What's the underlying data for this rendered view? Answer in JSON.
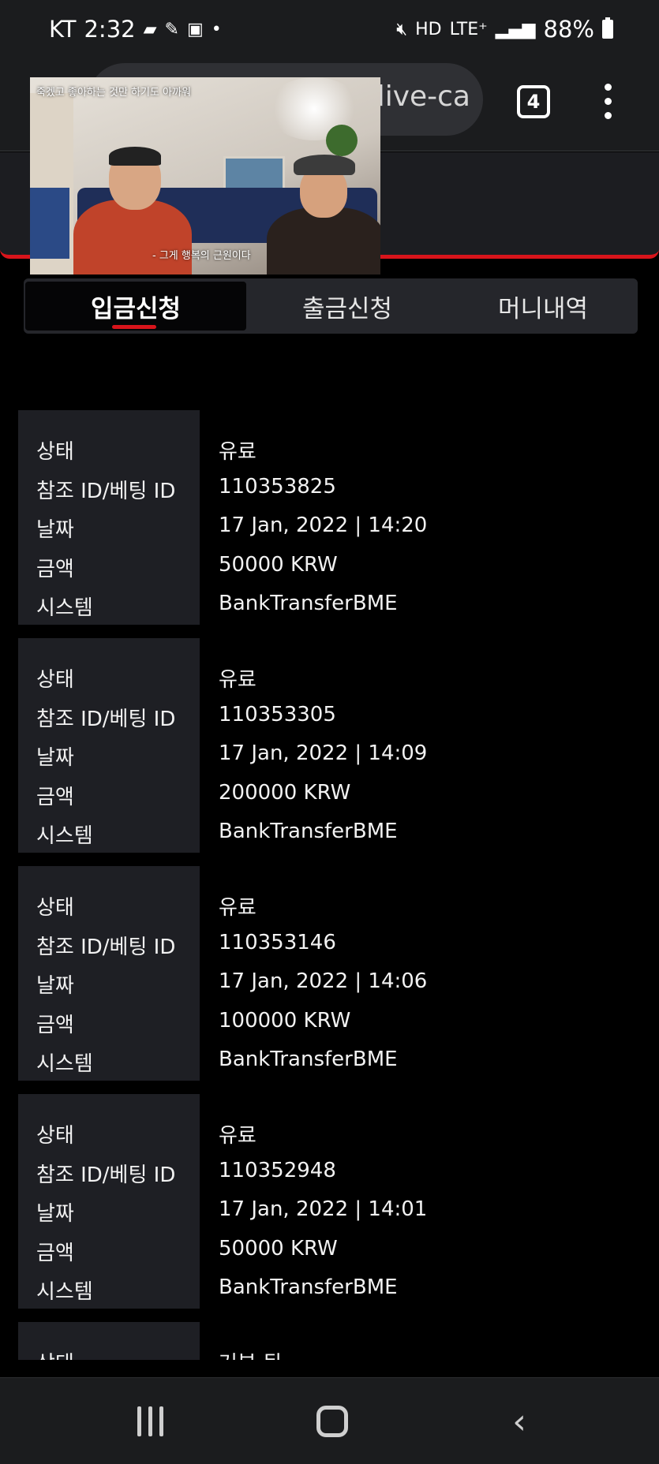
{
  "status_bar": {
    "carrier": "KT",
    "time": "2:32",
    "network": "LTE⁺",
    "battery": "88%",
    "icons": [
      "chat-icon",
      "volte-icon",
      "image-icon",
      "dot-icon",
      "mute-icon",
      "hd-icon",
      "signal-icon",
      "battery-icon"
    ]
  },
  "browser": {
    "url": "/live-ca",
    "tab_count": "4"
  },
  "video": {
    "top_caption": "죽겠고 좋아하는 것만 하기도 아까워",
    "subtitle": "- 그게 행복의 근원이다"
  },
  "tabs": [
    {
      "label": "입금신청",
      "active": true
    },
    {
      "label": "출금신청",
      "active": false
    },
    {
      "label": "머니내역",
      "active": false
    }
  ],
  "labels": {
    "status": "상태",
    "ref_id": "참조 ID/베팅 ID",
    "date": "날짜",
    "amount": "금액",
    "system": "시스템"
  },
  "records": [
    {
      "status": "유료",
      "ref_id": "110353825",
      "date": "17 Jan, 2022 | 14:20",
      "amount": "50000 KRW",
      "system": "BankTransferBME"
    },
    {
      "status": "유료",
      "ref_id": "110353305",
      "date": "17 Jan, 2022 | 14:09",
      "amount": "200000 KRW",
      "system": "BankTransferBME"
    },
    {
      "status": "유료",
      "ref_id": "110353146",
      "date": "17 Jan, 2022 | 14:06",
      "amount": "100000 KRW",
      "system": "BankTransferBME"
    },
    {
      "status": "유료",
      "ref_id": "110352948",
      "date": "17 Jan, 2022 | 14:01",
      "amount": "50000 KRW",
      "system": "BankTransferBME"
    }
  ],
  "partial_record": {
    "label": "상태",
    "value": "거부 됨"
  },
  "colors": {
    "accent": "#d8141b",
    "background": "#000000",
    "label_column": "#1e1f24",
    "tabbar": "#25262b"
  }
}
